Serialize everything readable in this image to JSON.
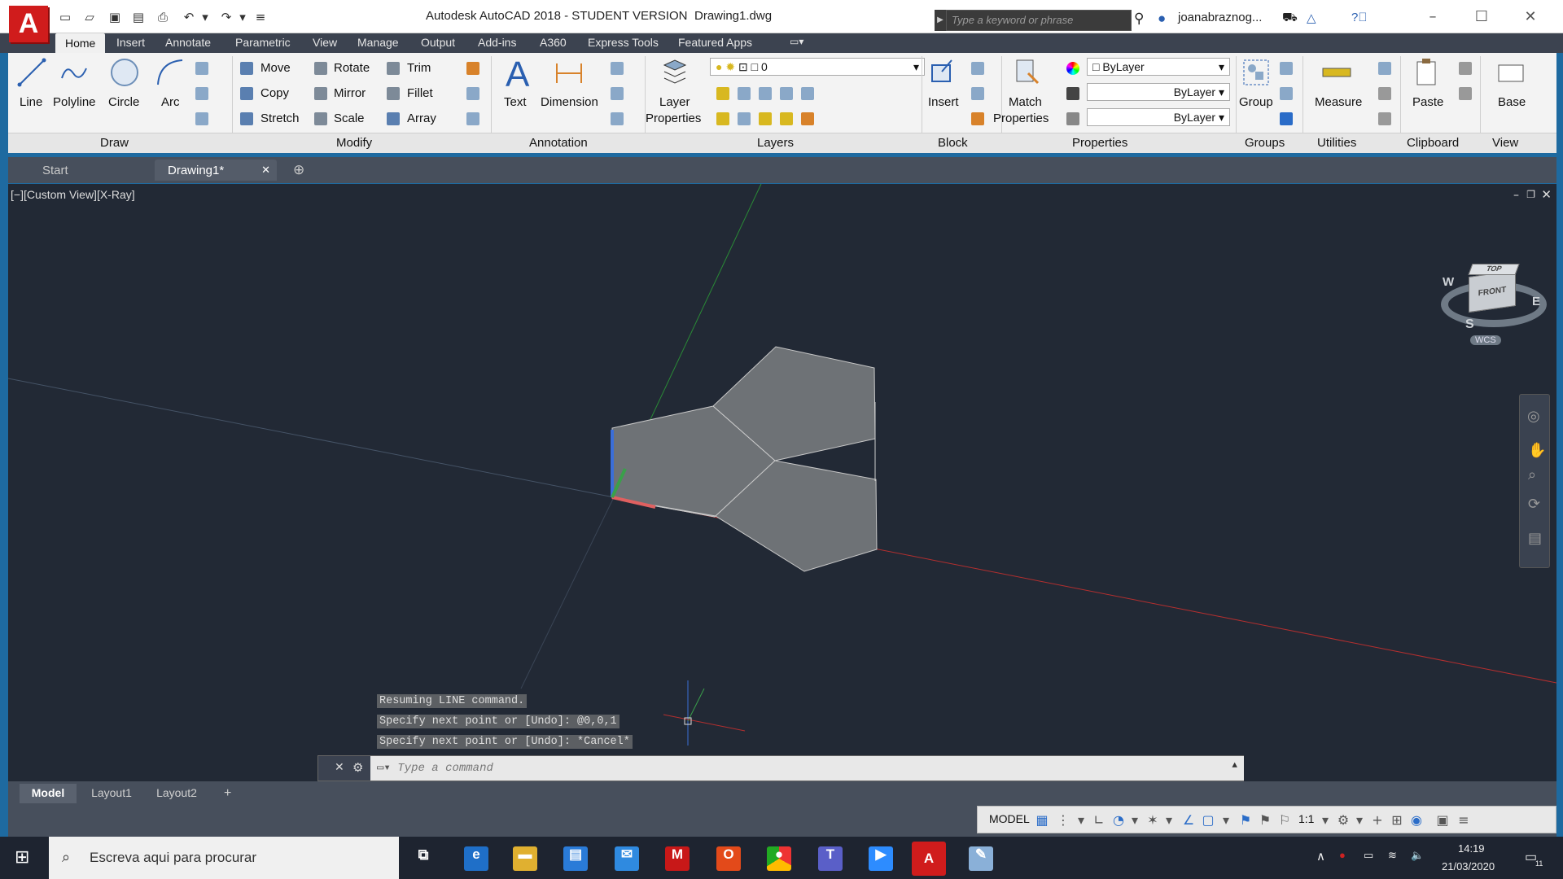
{
  "app": {
    "logo_letter": "A",
    "title": "Autodesk AutoCAD 2018 - STUDENT VERSION",
    "filename": "Drawing1.dwg",
    "search_placeholder": "Type a keyword or phrase",
    "user": "joanabraznog..."
  },
  "menu": {
    "tabs": [
      "Home",
      "Insert",
      "Annotate",
      "Parametric",
      "View",
      "Manage",
      "Output",
      "Add-ins",
      "A360",
      "Express Tools",
      "Featured Apps"
    ]
  },
  "ribbon": {
    "draw": {
      "line": "Line",
      "polyline": "Polyline",
      "circle": "Circle",
      "arc": "Arc",
      "panel": "Draw"
    },
    "modify": {
      "move": "Move",
      "rotate": "Rotate",
      "trim": "Trim",
      "copy": "Copy",
      "mirror": "Mirror",
      "fillet": "Fillet",
      "stretch": "Stretch",
      "scale": "Scale",
      "array": "Array",
      "panel": "Modify"
    },
    "annotation": {
      "text": "Text",
      "dimension": "Dimension",
      "panel": "Annotation"
    },
    "layers": {
      "layer_properties_1": "Layer",
      "layer_properties_2": "Properties",
      "current_layer": "0",
      "panel": "Layers"
    },
    "block": {
      "insert": "Insert",
      "panel": "Block"
    },
    "properties": {
      "match_1": "Match",
      "match_2": "Properties",
      "color": "ByLayer",
      "linetype": "ByLayer",
      "lineweight": "ByLayer",
      "panel": "Properties"
    },
    "groups": {
      "group": "Group",
      "panel": "Groups"
    },
    "utilities": {
      "measure": "Measure",
      "panel": "Utilities"
    },
    "clipboard": {
      "paste": "Paste",
      "panel": "Clipboard"
    },
    "view": {
      "base": "Base",
      "panel": "View"
    }
  },
  "file_tabs": {
    "start": "Start",
    "drawing": "Drawing1*"
  },
  "viewport": {
    "label": "[−][Custom View][X-Ray]",
    "viewcube": {
      "top": "TOP",
      "front": "FRONT",
      "w": "W",
      "e": "E",
      "s": "S",
      "wcs": "WCS"
    }
  },
  "command": {
    "history": [
      "Resuming LINE command.",
      "Specify next point or [Undo]: @0,0,1",
      "Specify next point or [Undo]: *Cancel*"
    ],
    "placeholder": "Type a command"
  },
  "layout_tabs": [
    "Model",
    "Layout1",
    "Layout2"
  ],
  "status": {
    "model": "MODEL",
    "scale": "1:1"
  },
  "taskbar": {
    "search_placeholder": "Escreva aqui para procurar",
    "time": "14:19",
    "date": "21/03/2020",
    "notifications": "11"
  },
  "colors": {
    "x_axis": "#c83434",
    "y_axis": "#2e8b3a",
    "z_axis": "#3b6ed8",
    "face": "#6e7276",
    "viewport_bg": "#222935"
  }
}
